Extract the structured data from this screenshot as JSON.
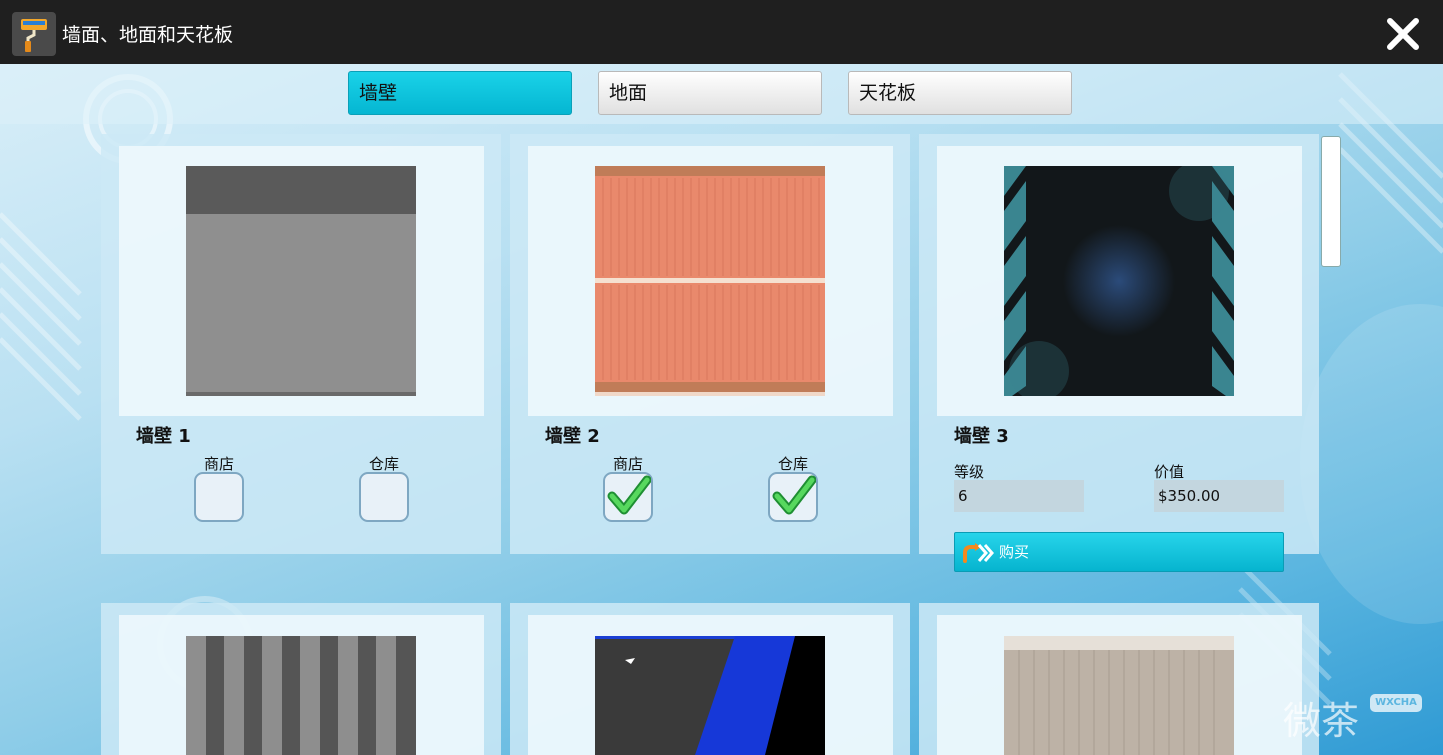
{
  "window": {
    "title": "墙面、地面和天花板"
  },
  "tabs": [
    {
      "label": "墙壁",
      "active": true
    },
    {
      "label": "地面",
      "active": false
    },
    {
      "label": "天花板",
      "active": false
    }
  ],
  "items": [
    {
      "name": "墙壁 1",
      "store_label": "商店",
      "warehouse_label": "仓库",
      "store_checked": false,
      "warehouse_checked": false
    },
    {
      "name": "墙壁 2",
      "store_label": "商店",
      "warehouse_label": "仓库",
      "store_checked": true,
      "warehouse_checked": true
    },
    {
      "name": "墙壁 3",
      "level_label": "等级",
      "level_value": "6",
      "price_label": "价值",
      "price_value": "$350.00",
      "buy_label": "购买"
    }
  ],
  "watermark": {
    "text": "微茶",
    "badge": "WXCHA"
  },
  "colors": {
    "titlebar": "#1f1f1f",
    "tab_active": "#05b6d2",
    "buy_button": "#06b4cf",
    "check": "#37c44a"
  }
}
